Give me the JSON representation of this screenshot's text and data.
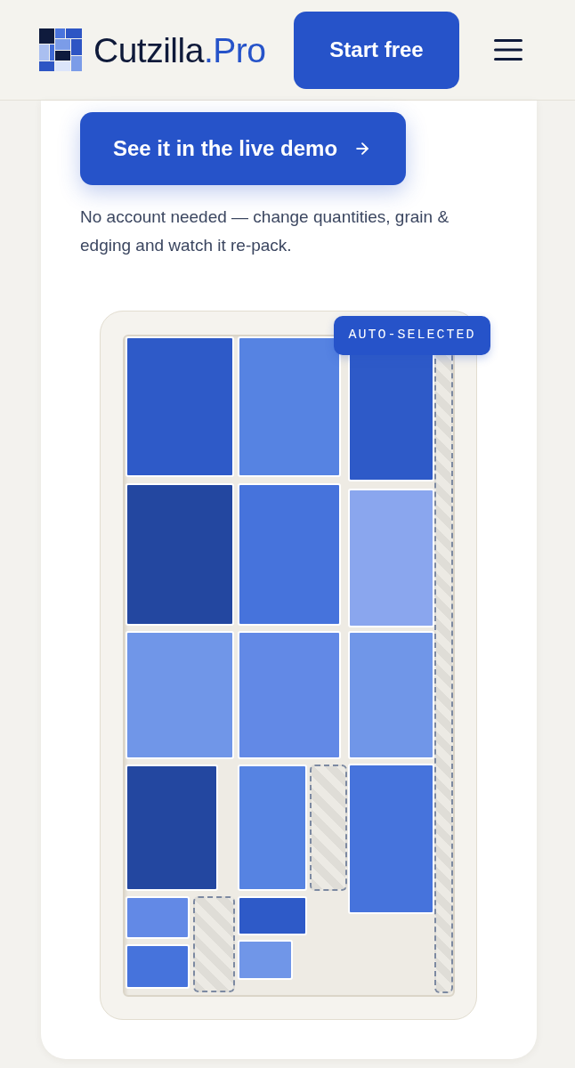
{
  "header": {
    "brand": {
      "name": "Cutzilla",
      "suffix": ".Pro"
    },
    "cta": "Start free"
  },
  "hero": {
    "demo_button": "See it in the live demo",
    "note": "No account needed — change quantities, grain & edging and watch it re-pack."
  },
  "sheet": {
    "badge": "AUTO-SELECTED",
    "pieces": [
      {
        "kind": "part",
        "color": "#2e5ac8"
      },
      {
        "kind": "part",
        "color": "#2347a0"
      },
      {
        "kind": "part",
        "color": "#7096e8"
      },
      {
        "kind": "part",
        "color": "#2347a0"
      },
      {
        "kind": "part",
        "color": "#6289e6"
      },
      {
        "kind": "part",
        "color": "#4673dc"
      },
      {
        "kind": "offcut"
      },
      {
        "kind": "part",
        "color": "#5683e2"
      },
      {
        "kind": "part",
        "color": "#4673dc"
      },
      {
        "kind": "part",
        "color": "#6289e6"
      },
      {
        "kind": "part",
        "color": "#5683e2"
      },
      {
        "kind": "offcut"
      },
      {
        "kind": "part",
        "color": "#2e5ac8"
      },
      {
        "kind": "part",
        "color": "#7096e8"
      },
      {
        "kind": "part",
        "color": "#2e5ac8"
      },
      {
        "kind": "part",
        "color": "#8aa6ee"
      },
      {
        "kind": "part",
        "color": "#7096e8"
      },
      {
        "kind": "part",
        "color": "#4673dc"
      },
      {
        "kind": "offcut"
      }
    ]
  }
}
